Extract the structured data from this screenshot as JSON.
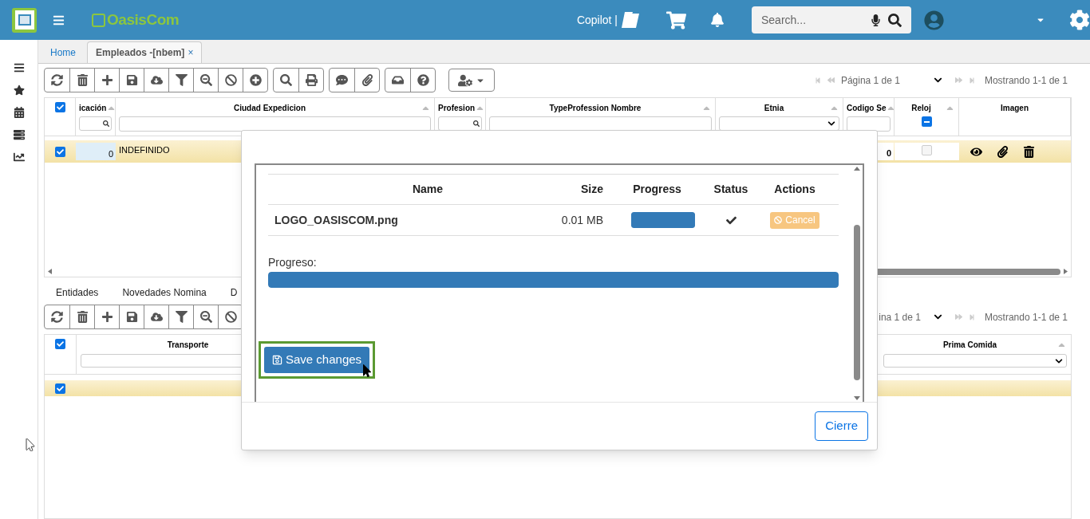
{
  "header": {
    "brand": "OasisCom",
    "copilot": "Copilot |",
    "search": {
      "placeholder": "Search..."
    }
  },
  "tabs": [
    {
      "label": "Home",
      "selected": false
    },
    {
      "label": "Empleados -[nbem]",
      "selected": true,
      "close": "×"
    }
  ],
  "grid": {
    "all_checked": true,
    "columns": [
      {
        "label": "icación",
        "kind": "search"
      },
      {
        "label": "Ciudad Expedicion",
        "kind": "input"
      },
      {
        "label": "Profesion",
        "kind": "search"
      },
      {
        "label": "TypeProfession Nombre",
        "kind": "input"
      },
      {
        "label": "Etnia",
        "kind": "select"
      },
      {
        "label": "Codigo Se",
        "kind": "input"
      },
      {
        "label": "Reloj",
        "kind": "checkbox",
        "indeterminate": true
      },
      {
        "label": "Imagen",
        "kind": "none"
      }
    ],
    "rows": [
      {
        "checked": true,
        "code": "0",
        "city": "INDEFINIDO",
        "sena": "0",
        "reloj": false
      }
    ]
  },
  "pager": {
    "page": "Página 1 de 1",
    "showing": "Mostrando 1-1 de 1"
  },
  "subtabs": [
    "Entidades",
    "Novedades Nomina",
    "D"
  ],
  "pager2": {
    "page": "ina 1 de 1",
    "showing": "Mostrando 1-1 de 1"
  },
  "grid2": {
    "all_checked": true,
    "columns": [
      "Transporte",
      "Prima Comida"
    ],
    "rows": [
      {
        "checked": true
      }
    ]
  },
  "modal": {
    "columns": [
      "Name",
      "Size",
      "Progress",
      "Status",
      "Actions"
    ],
    "files": [
      {
        "name": "LOGO_OASISCOM.png",
        "size": "0.01 MB",
        "level": 1,
        "done": true,
        "action": "Cancel",
        "action_disabled": true
      }
    ],
    "progress_label": "Progreso:",
    "level": 1,
    "save": "Save changes",
    "close": "Cierre"
  }
}
